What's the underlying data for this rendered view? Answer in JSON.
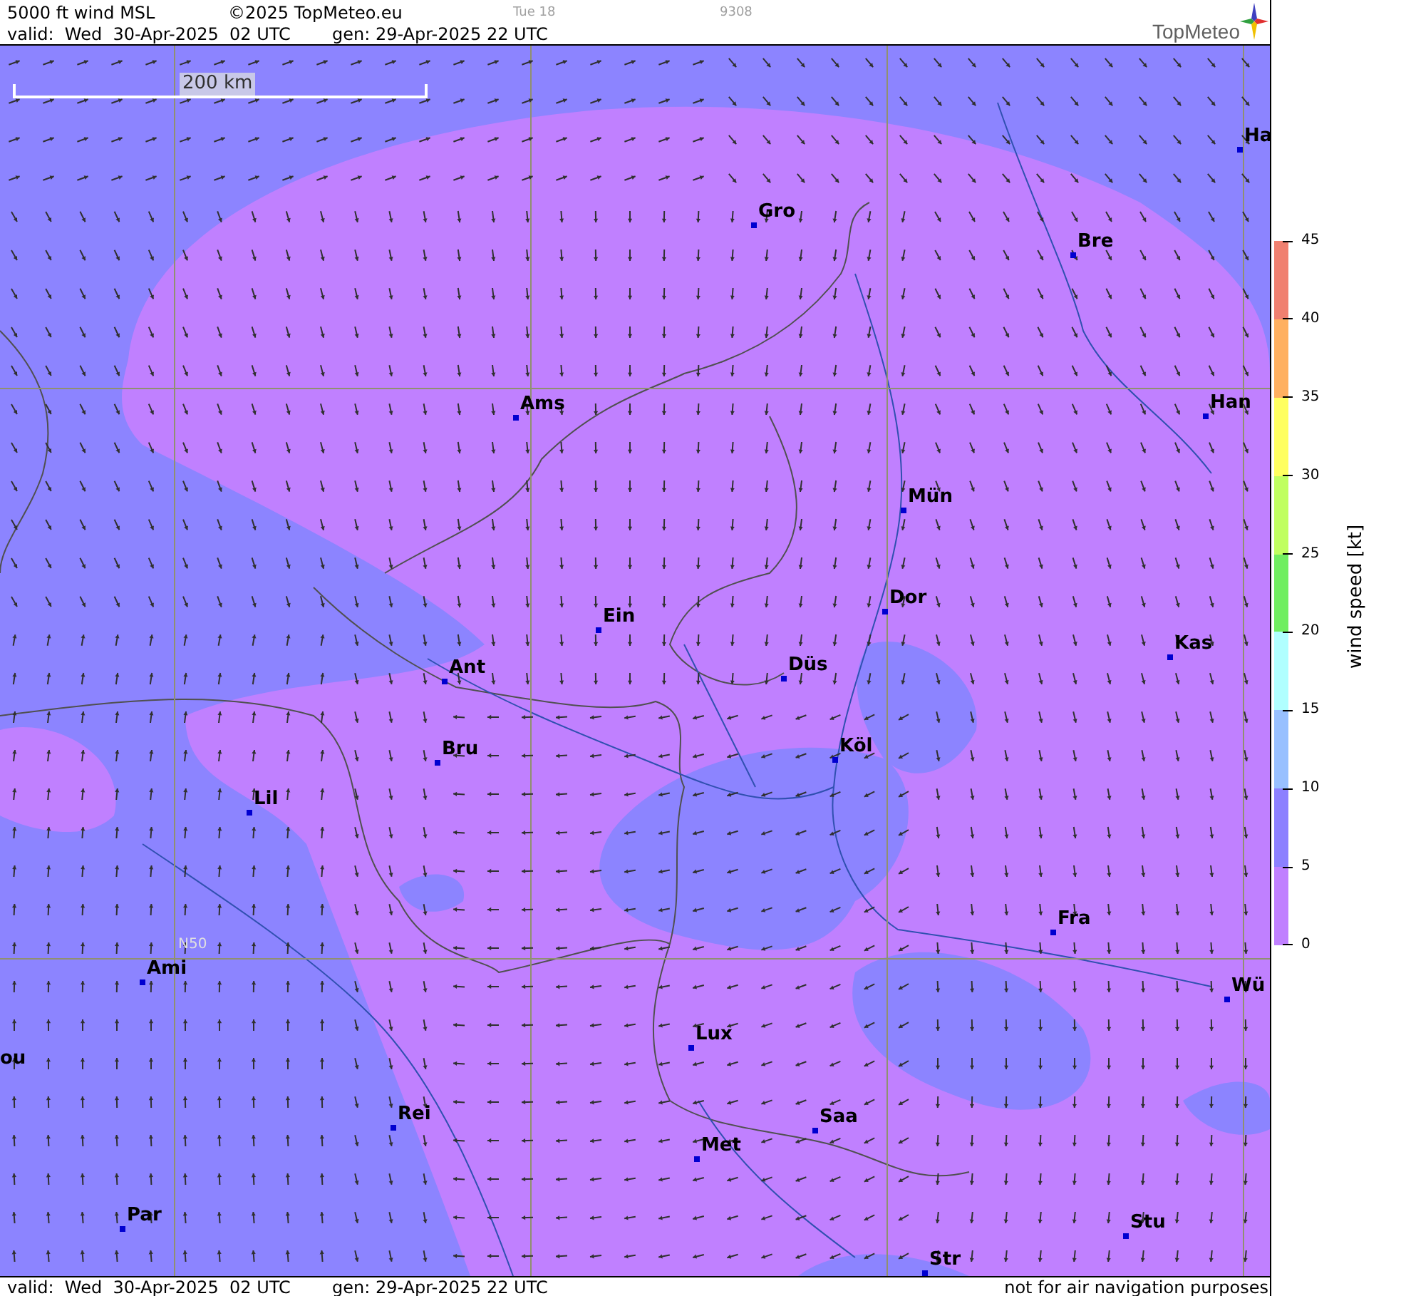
{
  "header": {
    "product": "5000 ft wind MSL",
    "copyright": "©2025 TopMeteo.eu",
    "run_day": "Tue 18",
    "code": "9308",
    "valid": "valid:  Wed  30-Apr-2025  02 UTC",
    "generated": "gen: 29-Apr-2025 22 UTC",
    "logo": "TopMeteo"
  },
  "map": {
    "scale_bar": "200 km",
    "grid_labels": [
      "N50"
    ],
    "cities": [
      {
        "label": "Ha"
      },
      {
        "label": "Gro"
      },
      {
        "label": "Bre"
      },
      {
        "label": "Ams"
      },
      {
        "label": "Han"
      },
      {
        "label": "Mün"
      },
      {
        "label": "Ein"
      },
      {
        "label": "Dor"
      },
      {
        "label": "Kas"
      },
      {
        "label": "Ant"
      },
      {
        "label": "Düs"
      },
      {
        "label": "Bru"
      },
      {
        "label": "Köl"
      },
      {
        "label": "Lil"
      },
      {
        "label": "Fra"
      },
      {
        "label": "Ami"
      },
      {
        "label": "Wü"
      },
      {
        "label": "Lux"
      },
      {
        "label": "ou"
      },
      {
        "label": "Rei"
      },
      {
        "label": "Saa"
      },
      {
        "label": "Met"
      },
      {
        "label": "Par"
      },
      {
        "label": "Stu"
      },
      {
        "label": "Str"
      }
    ]
  },
  "legend": {
    "title": "wind speed [kt]",
    "ticks": [
      "45",
      "40",
      "35",
      "30",
      "25",
      "20",
      "15",
      "10",
      "5",
      "0"
    ],
    "bands": [
      {
        "color": "#f08070"
      },
      {
        "color": "#ffb060"
      },
      {
        "color": "#ffff60"
      },
      {
        "color": "#c0ff60"
      },
      {
        "color": "#70ee60"
      },
      {
        "color": "#b0ffff"
      },
      {
        "color": "#98c0ff"
      },
      {
        "color": "#8c80ff"
      },
      {
        "color": "#c080ff"
      }
    ]
  },
  "footer": {
    "valid": "valid:  Wed  30-Apr-2025  02 UTC",
    "generated": "gen: 29-Apr-2025 22 UTC",
    "disclaimer": "not for air navigation purposes"
  }
}
